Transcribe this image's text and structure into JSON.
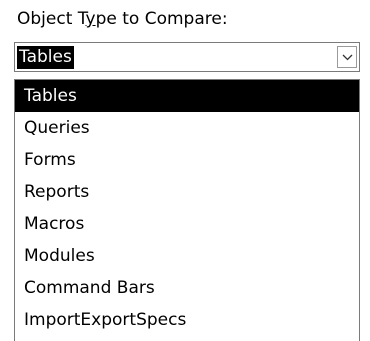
{
  "label": {
    "before_access_key": "Object T",
    "access_key": "y",
    "after_access_key": "pe to Compare:"
  },
  "combo": {
    "value": "Tables",
    "button_icon": "chevron-down-icon"
  },
  "options": [
    {
      "label": "Tables",
      "selected": true
    },
    {
      "label": "Queries",
      "selected": false
    },
    {
      "label": "Forms",
      "selected": false
    },
    {
      "label": "Reports",
      "selected": false
    },
    {
      "label": "Macros",
      "selected": false
    },
    {
      "label": "Modules",
      "selected": false
    },
    {
      "label": "Command Bars",
      "selected": false
    },
    {
      "label": "ImportExportSpecs",
      "selected": false
    }
  ],
  "colors": {
    "selection_background": "#000000",
    "selection_text": "#ffffff",
    "border": "#7a7a7a"
  }
}
